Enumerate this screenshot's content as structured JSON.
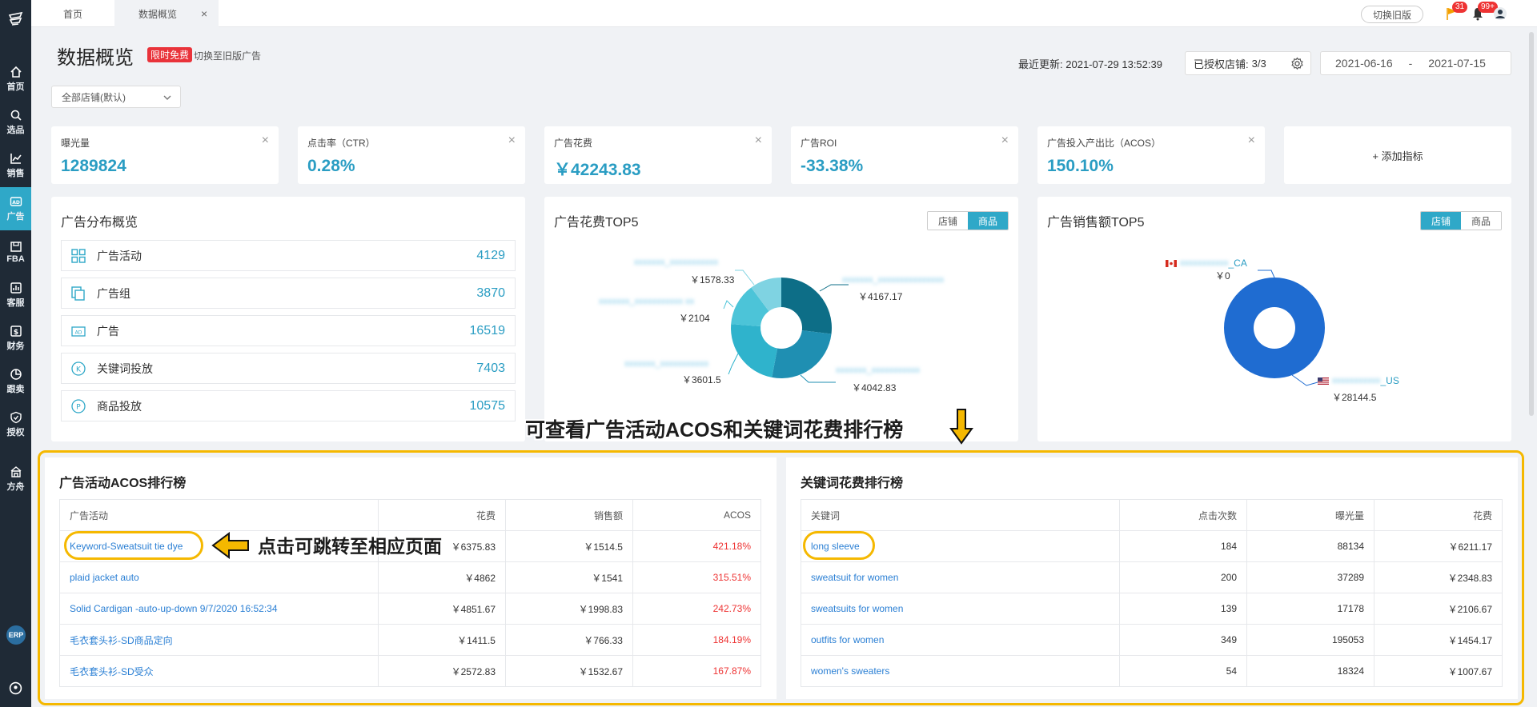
{
  "colors": {
    "accent": "#2fa8c8",
    "sidebar_bg": "#1f2a36",
    "highlight": "#f5b800",
    "link": "#2a7fd4",
    "negative": "#e33"
  },
  "sidebar": {
    "items": [
      {
        "label": "首页",
        "icon": "home-icon"
      },
      {
        "label": "选品",
        "icon": "search-icon"
      },
      {
        "label": "销售",
        "icon": "chart-line-icon"
      },
      {
        "label": "广告",
        "icon": "ad-icon"
      },
      {
        "label": "FBA",
        "icon": "box-icon"
      },
      {
        "label": "客服",
        "icon": "service-icon"
      },
      {
        "label": "财务",
        "icon": "dollar-icon"
      },
      {
        "label": "跟卖",
        "icon": "pie-icon"
      },
      {
        "label": "授权",
        "icon": "shield-icon"
      },
      {
        "label": "方舟",
        "icon": "ark-icon"
      }
    ],
    "erp": "ERP"
  },
  "topbar": {
    "tabs": [
      {
        "label": "首页"
      },
      {
        "label": "数据概览"
      }
    ],
    "close": "×",
    "old_version": "切换旧版",
    "flag_badge": "31",
    "bell_badge": "99+"
  },
  "header": {
    "title": "数据概览",
    "free_tag": "限时免费",
    "switch_link": "切换至旧版广告",
    "last_update_label": "最近更新:",
    "last_update": "2021-07-29 13:52:39",
    "auth_label": "已授权店铺:",
    "auth_value": "3/3",
    "date_from": "2021-06-16",
    "date_sep": "-",
    "date_to": "2021-07-15",
    "store_select": "全部店铺(默认)"
  },
  "metrics": [
    {
      "label": "曝光量",
      "value": "1289824"
    },
    {
      "label": "点击率（CTR）",
      "value": "0.28%"
    },
    {
      "label": "广告花费",
      "value": "￥42243.83"
    },
    {
      "label": "广告ROI",
      "value": "-33.38%"
    },
    {
      "label": "广告投入产出比（ACOS）",
      "value": "150.10%"
    }
  ],
  "add_metric": "+ 添加指标",
  "distribution": {
    "title": "广告分布概览",
    "rows": [
      {
        "label": "广告活动",
        "value": "4129",
        "icon": "grid-icon"
      },
      {
        "label": "广告组",
        "value": "3870",
        "icon": "copy-icon"
      },
      {
        "label": "广告",
        "value": "16519",
        "icon": "ad-icon"
      },
      {
        "label": "关键词投放",
        "value": "7403",
        "icon": "k-circle-icon"
      },
      {
        "label": "商品投放",
        "value": "10575",
        "icon": "p-circle-icon"
      }
    ]
  },
  "spend_top5": {
    "title": "广告花费TOP5",
    "seg": [
      "店铺",
      "商品"
    ],
    "labels": [
      "￥1578.33",
      "￥4167.17",
      "￥2104",
      "￥3601.5",
      "￥4042.83"
    ],
    "chart_data": {
      "type": "pie",
      "values": [
        4167.17,
        4042.83,
        3601.5,
        2104,
        1578.33
      ],
      "colors": [
        "#0d6e87",
        "#1f8fb2",
        "#2fb3cc",
        "#4cc4d8",
        "#7fd3e2"
      ]
    }
  },
  "sales_top5": {
    "title": "广告销售额TOP5",
    "seg": [
      "店铺",
      "商品"
    ],
    "ca_suffix": "_CA",
    "us_suffix": "_US",
    "labels": [
      "￥0",
      "￥28144.5"
    ],
    "chart_data": {
      "type": "pie",
      "values": [
        0,
        28144.5
      ],
      "colors": [
        "#e05555",
        "#1f6cd1"
      ]
    }
  },
  "annotations": {
    "banner": "可查看广告活动ACOS和关键词花费排行榜",
    "click_note": "点击可跳转至相应页面"
  },
  "acos_table": {
    "title": "广告活动ACOS排行榜",
    "headers": [
      "广告活动",
      "花费",
      "销售额",
      "ACOS"
    ],
    "rows": [
      [
        "Keyword-Sweatsuit tie dye",
        "￥6375.83",
        "￥1514.5",
        "421.18%"
      ],
      [
        "plaid jacket auto",
        "￥4862",
        "￥1541",
        "315.51%"
      ],
      [
        "Solid Cardigan -auto-up-down 9/7/2020 16:52:34",
        "￥4851.67",
        "￥1998.83",
        "242.73%"
      ],
      [
        "毛衣套头衫-SD商品定向",
        "￥1411.5",
        "￥766.33",
        "184.19%"
      ],
      [
        "毛衣套头衫-SD受众",
        "￥2572.83",
        "￥1532.67",
        "167.87%"
      ]
    ]
  },
  "keyword_table": {
    "title": "关键词花费排行榜",
    "headers": [
      "关键词",
      "点击次数",
      "曝光量",
      "花费"
    ],
    "rows": [
      [
        "long sleeve",
        "184",
        "88134",
        "￥6211.17"
      ],
      [
        "sweatsuit for women",
        "200",
        "37289",
        "￥2348.83"
      ],
      [
        "sweatsuits for women",
        "139",
        "17178",
        "￥2106.67"
      ],
      [
        "outfits for women",
        "349",
        "195053",
        "￥1454.17"
      ],
      [
        "women's sweaters",
        "54",
        "18324",
        "￥1007.67"
      ]
    ]
  }
}
